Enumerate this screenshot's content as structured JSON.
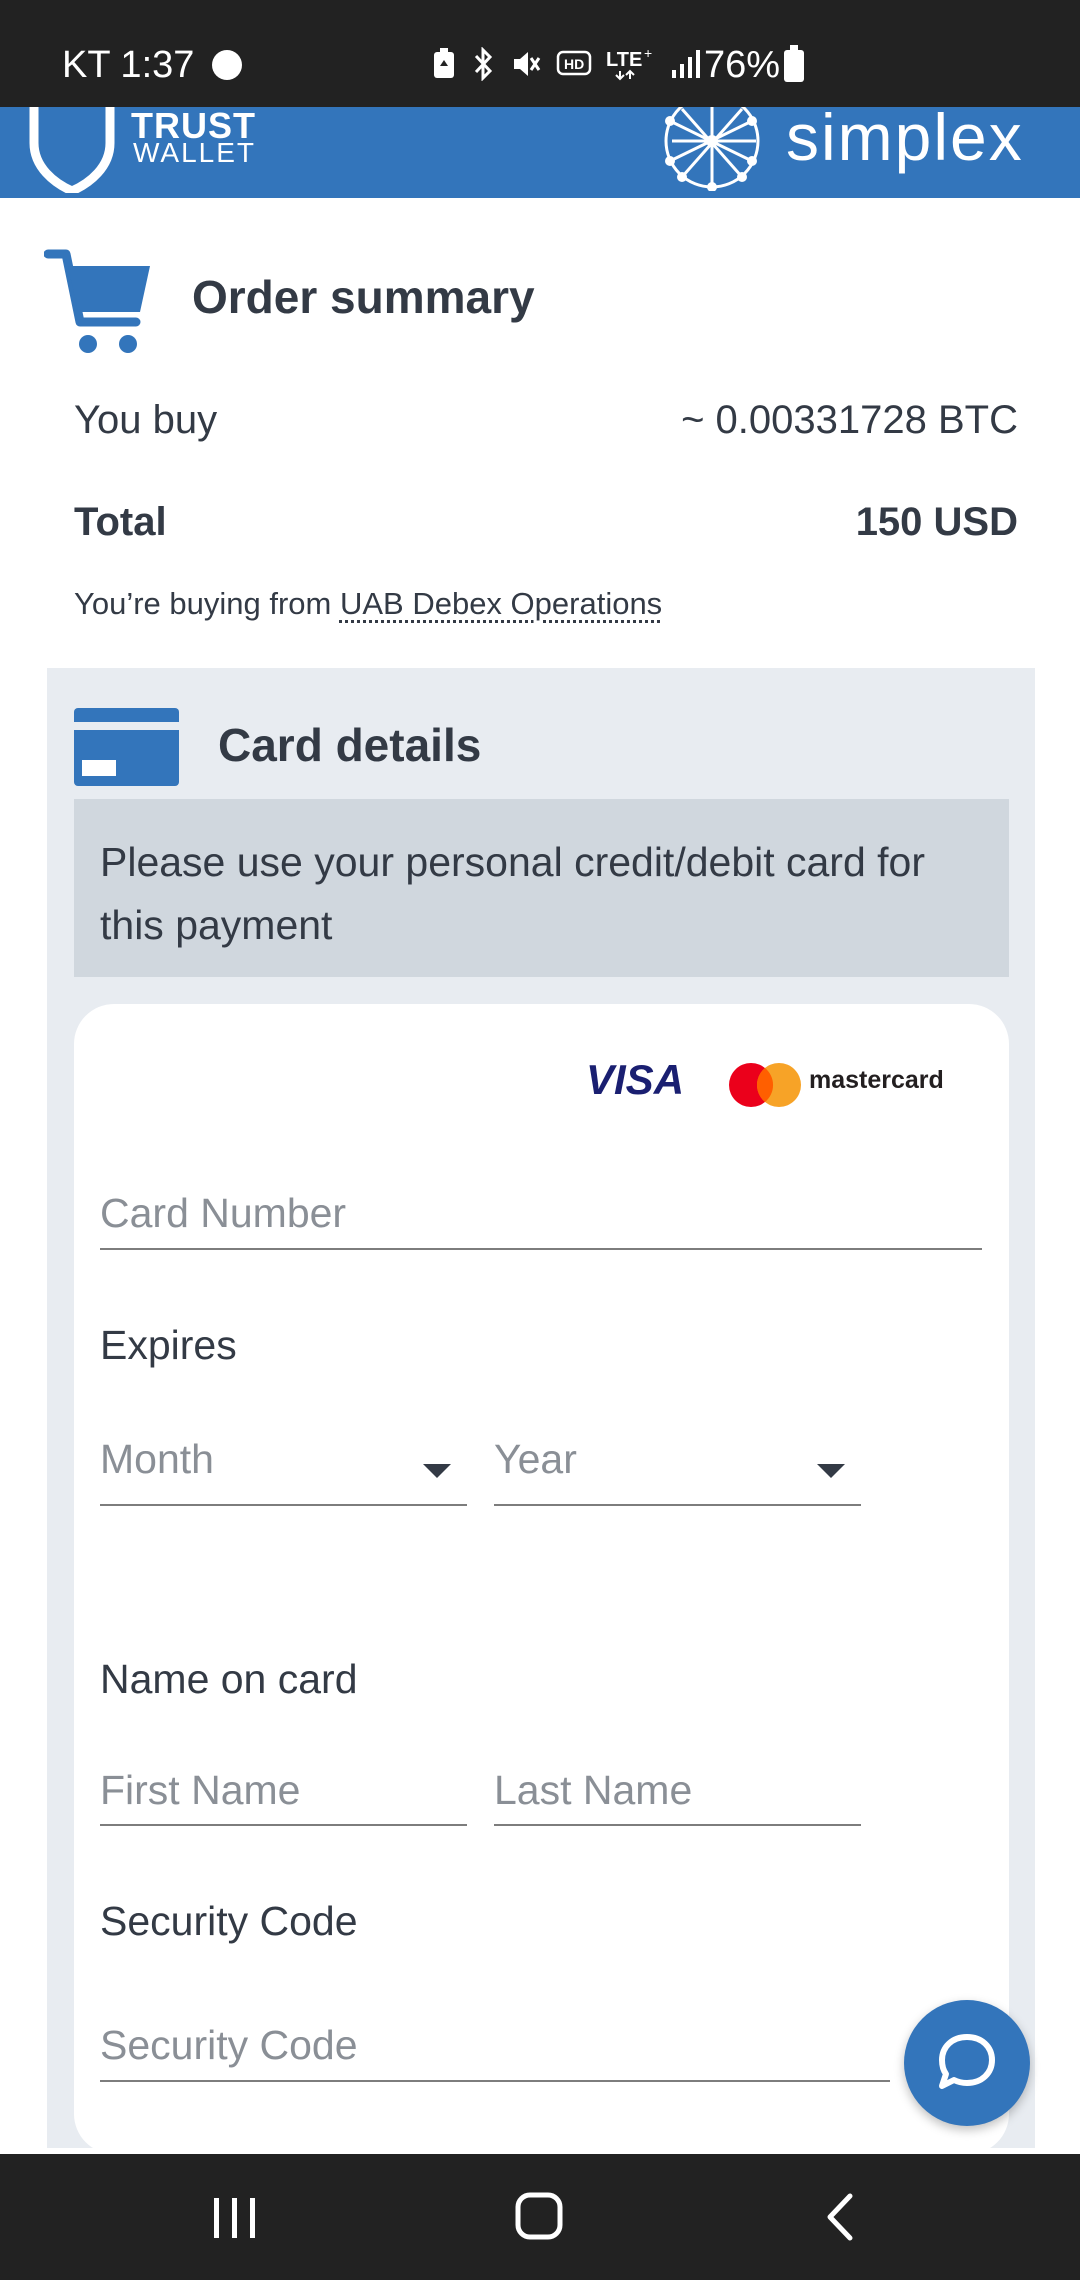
{
  "status_bar": {
    "time": "KT 1:37",
    "battery": "76%",
    "icons": [
      "battery-saver-icon",
      "bluetooth-icon",
      "mute-icon",
      "hd-icon",
      "lte-icon",
      "signal-icon"
    ]
  },
  "header": {
    "brand_left_line1": "TRUST",
    "brand_left_line2": "WALLET",
    "brand_right": "simplex",
    "color": "#3375bb"
  },
  "order_summary": {
    "title": "Order summary",
    "you_buy_label": "You buy",
    "you_buy_value": "~ 0.00331728 BTC",
    "total_label": "Total",
    "total_value": "150 USD",
    "buying_from_prefix": "You’re buying from",
    "merchant": "UAB Debex Operations"
  },
  "card_details": {
    "title": "Card details",
    "notice": "Please use your personal credit/debit card for this payment",
    "card_brands": [
      "VISA",
      "mastercard"
    ],
    "card_number_placeholder": "Card Number",
    "expires_label": "Expires",
    "month_placeholder": "Month",
    "year_placeholder": "Year",
    "name_label": "Name on card",
    "first_name_placeholder": "First Name",
    "last_name_placeholder": "Last Name",
    "security_label": "Security Code",
    "security_placeholder": "Security Code"
  },
  "chat": {
    "icon": "chat-bubble-icon"
  },
  "nav": {
    "icons": [
      "recent-apps-icon",
      "home-icon",
      "back-icon"
    ]
  }
}
